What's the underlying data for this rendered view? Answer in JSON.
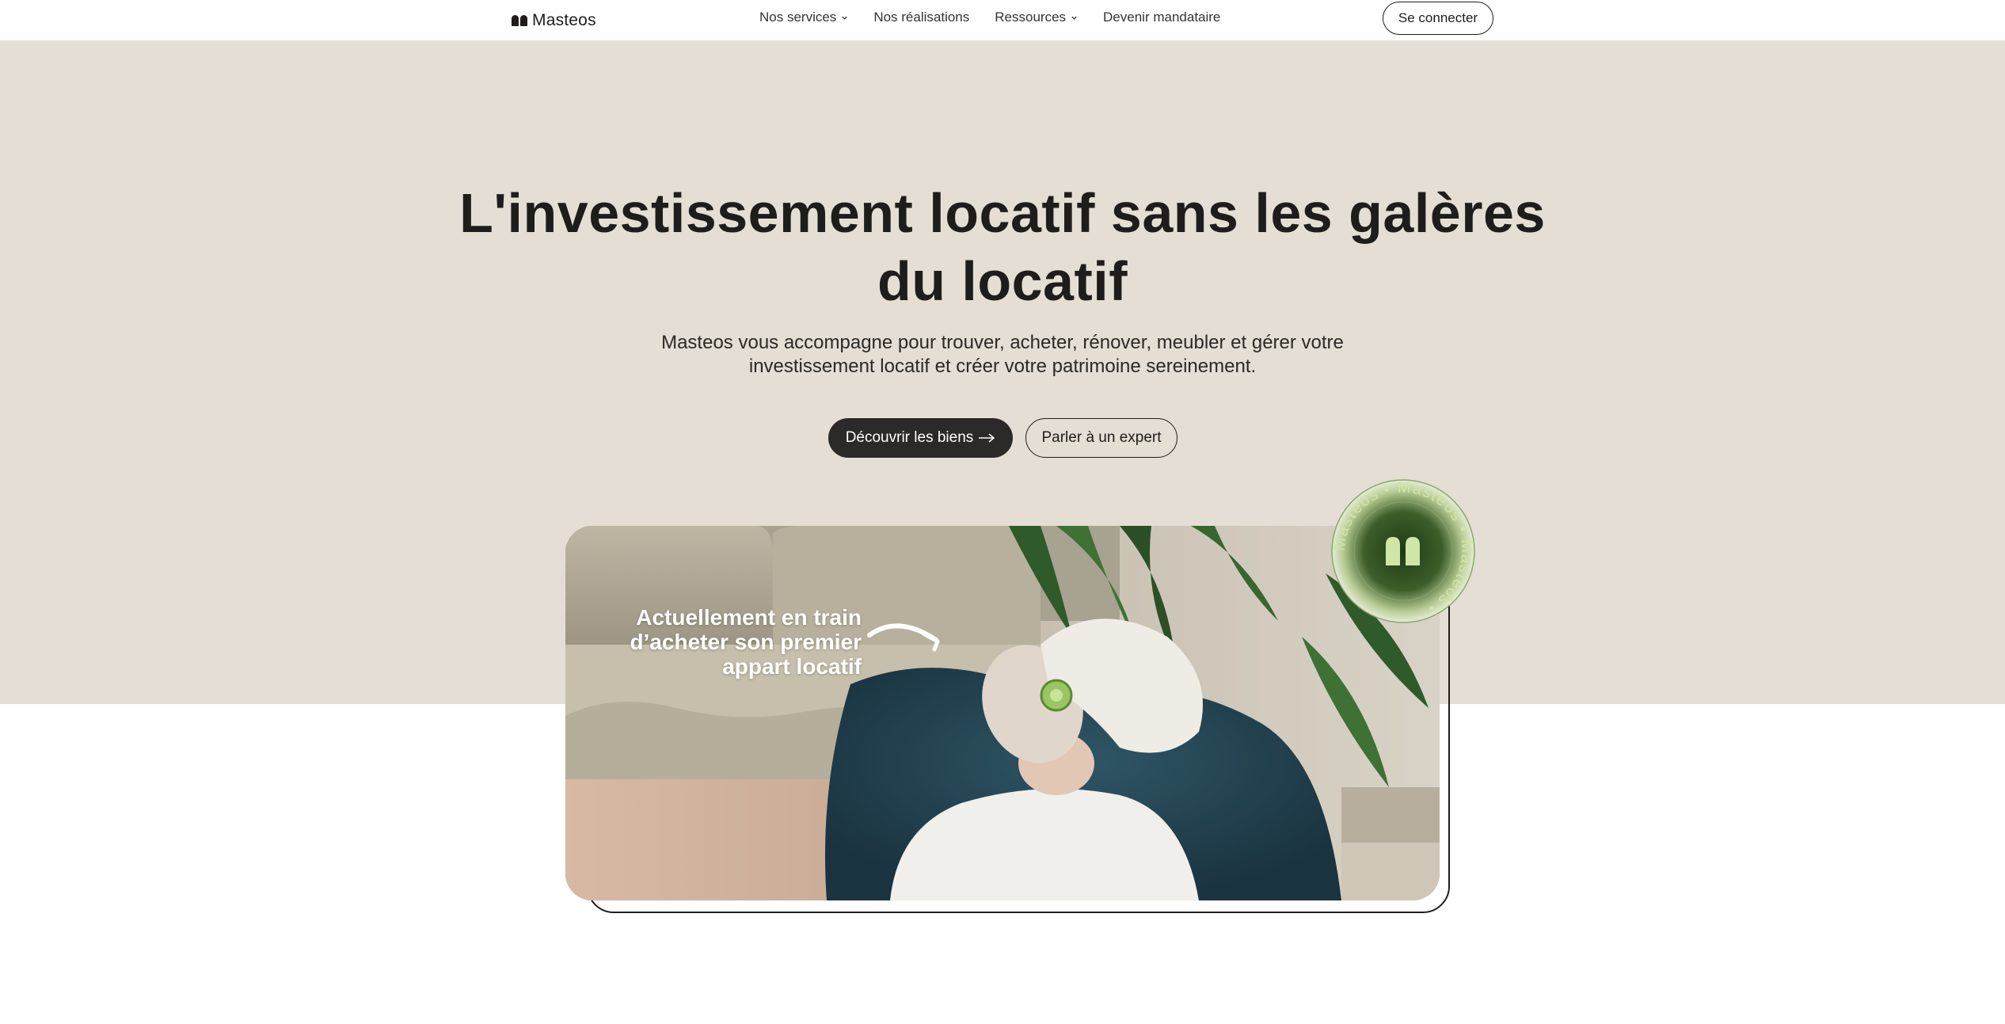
{
  "nav": {
    "brand": "Masteos",
    "links": [
      {
        "label": "Nos services",
        "has_dropdown": true
      },
      {
        "label": "Nos réalisations",
        "has_dropdown": false
      },
      {
        "label": "Ressources",
        "has_dropdown": true
      },
      {
        "label": "Devenir mandataire",
        "has_dropdown": false
      }
    ],
    "login_label": "Se connecter"
  },
  "hero": {
    "title_line1": "L'investissement locatif sans les galères",
    "title_line2": "du locatif",
    "subtitle_line1": "Masteos vous accompagne pour trouver, acheter, rénover, meubler et gérer votre",
    "subtitle_line2": "investissement locatif et créer votre patrimoine sereinement.",
    "cta_primary": "Découvrir les biens",
    "cta_secondary": "Parler à un expert"
  },
  "photo": {
    "caption_line1": "Actuellement en train",
    "caption_line2": "d’acheter son premier",
    "caption_line3": "appart locatif",
    "subject": "woman-relaxing-face-mask-icon"
  },
  "badge": {
    "ring_text": "Masteos • Masteos • Masteos • ",
    "icon": "masteos-logo-icon"
  },
  "colors": {
    "hero_bg": "#e4ded5",
    "primary_button": "#2c2a28",
    "badge_text": "#c9e3a4",
    "badge_core": "#2c4a1e"
  }
}
